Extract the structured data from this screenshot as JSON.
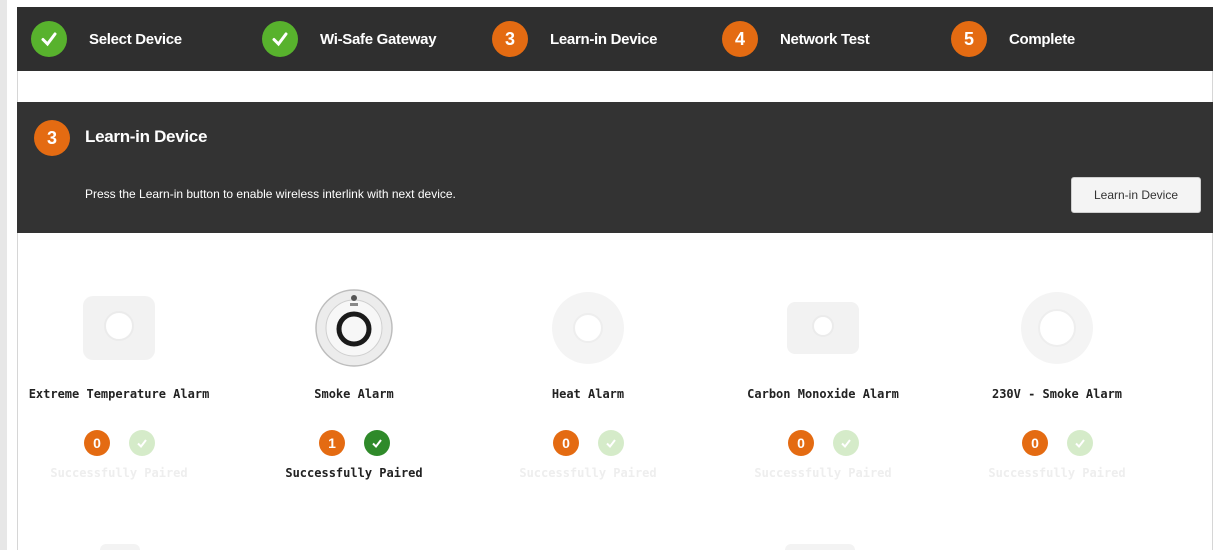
{
  "wizard": {
    "steps": [
      {
        "label": "Select Device",
        "marker": "",
        "status": "done"
      },
      {
        "label": "Wi-Safe Gateway",
        "marker": "",
        "status": "done"
      },
      {
        "label": "Learn-in Device",
        "marker": "3",
        "status": "current"
      },
      {
        "label": "Network Test",
        "marker": "4",
        "status": "todo"
      },
      {
        "label": "Complete",
        "marker": "5",
        "status": "todo"
      }
    ]
  },
  "panel": {
    "number": "3",
    "title": "Learn-in Device",
    "description": "Press the Learn-in button to enable wireless interlink with next device.",
    "button_label": "Learn-in Device"
  },
  "devices": [
    {
      "name": "Extreme Temperature Alarm",
      "count": "0",
      "paired_label": "Successfully Paired",
      "paired": false,
      "icon": "extreme-temperature-alarm-icon"
    },
    {
      "name": "Smoke Alarm",
      "count": "1",
      "paired_label": "Successfully Paired",
      "paired": true,
      "icon": "smoke-alarm-icon"
    },
    {
      "name": "Heat Alarm",
      "count": "0",
      "paired_label": "Successfully Paired",
      "paired": false,
      "icon": "heat-alarm-icon"
    },
    {
      "name": "Carbon Monoxide Alarm",
      "count": "0",
      "paired_label": "Successfully Paired",
      "paired": false,
      "icon": "carbon-monoxide-alarm-icon"
    },
    {
      "name": "230V - Smoke Alarm",
      "count": "0",
      "paired_label": "Successfully Paired",
      "paired": false,
      "icon": "smoke-alarm-230v-icon"
    }
  ],
  "colors": {
    "done": "#58b22d",
    "pending": "#e46b12",
    "header": "#2f2f2f",
    "paired": "#2f8a2a"
  }
}
